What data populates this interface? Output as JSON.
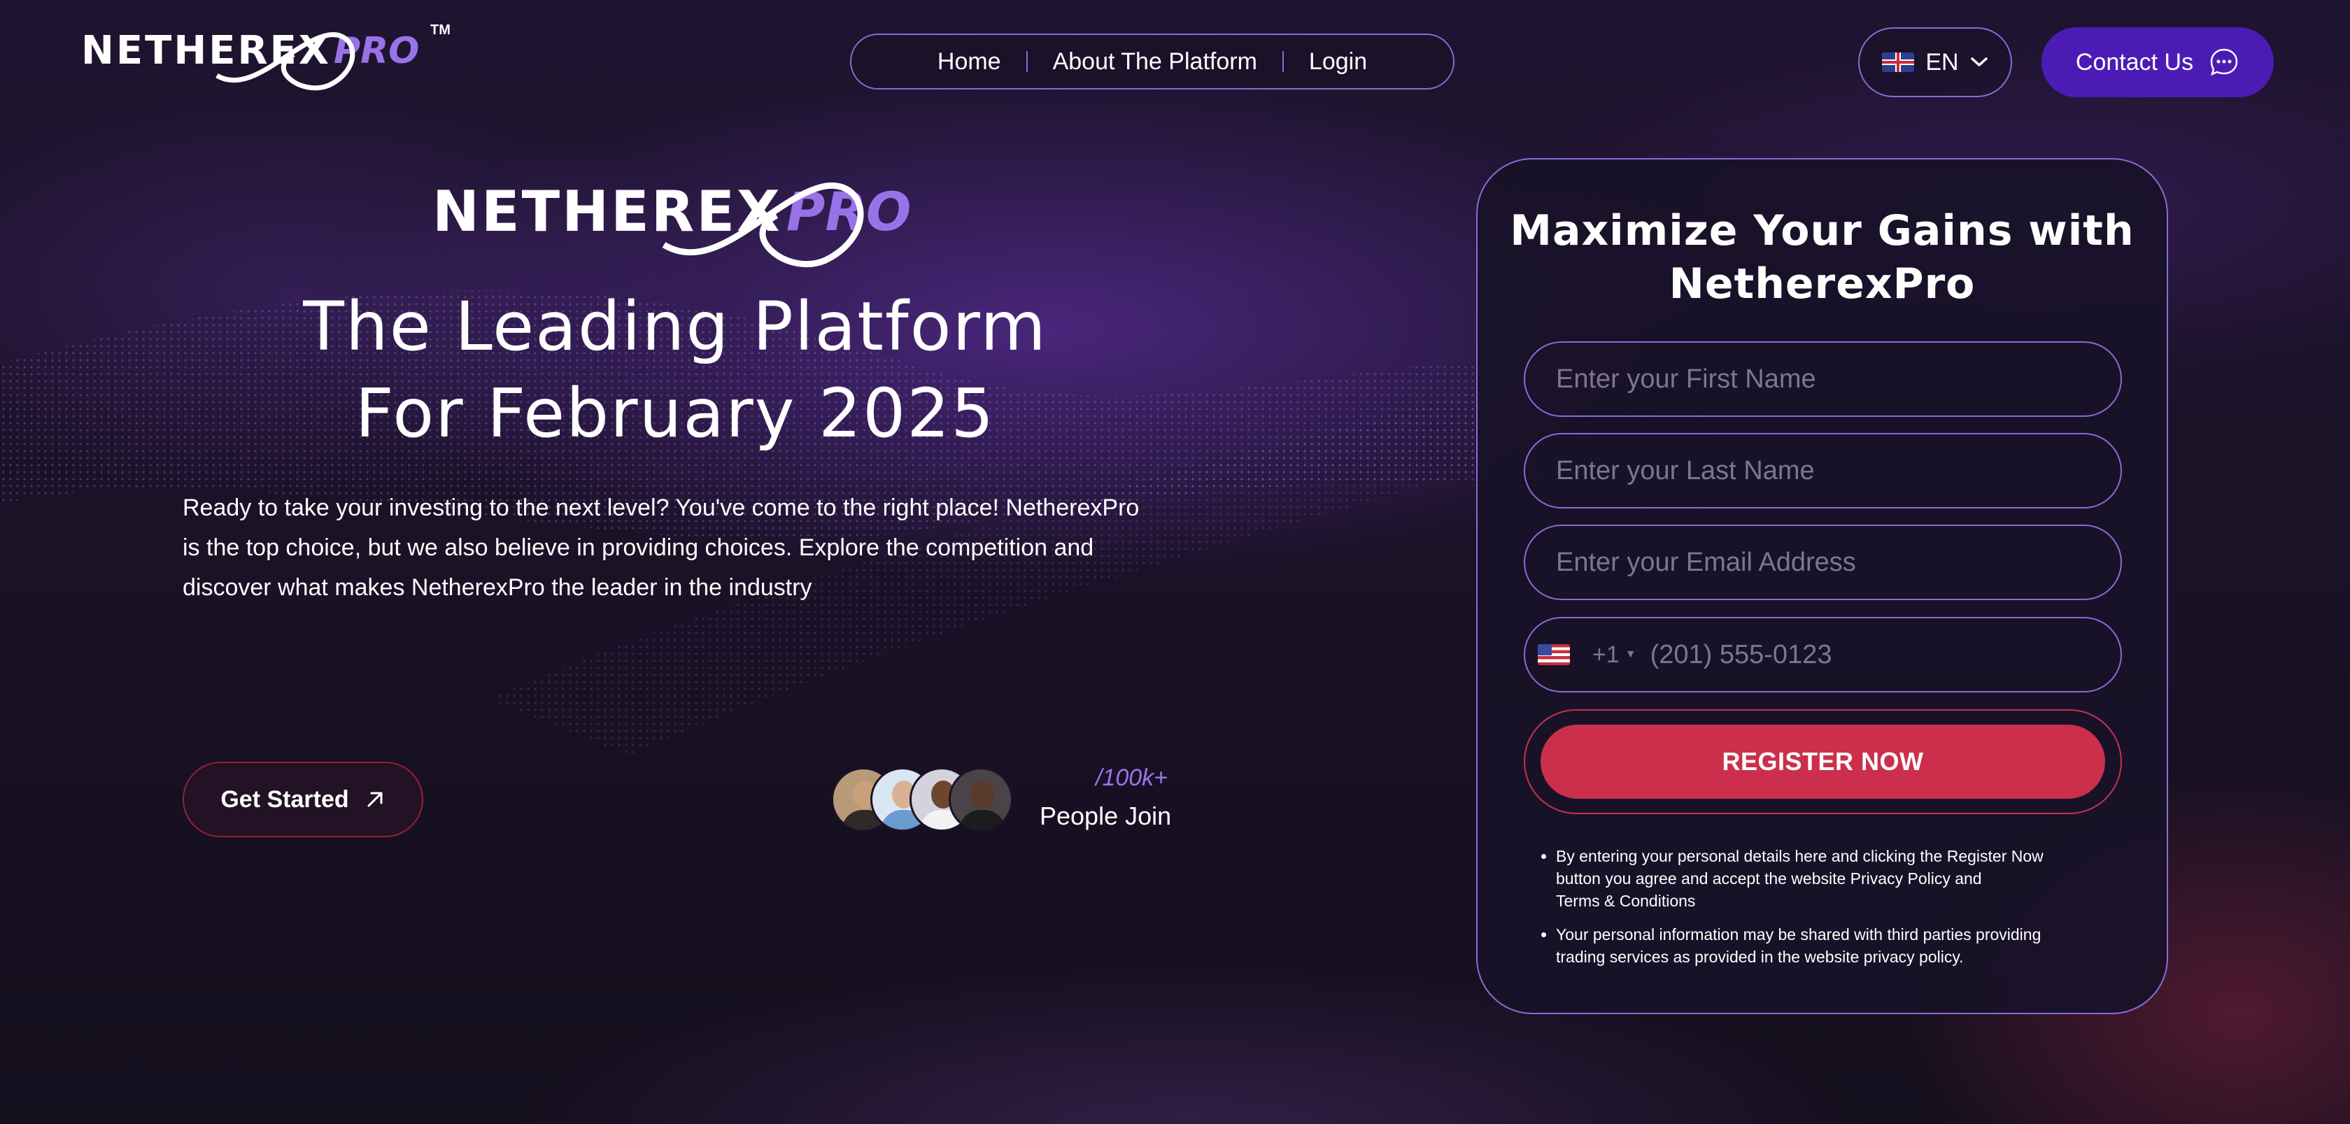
{
  "brand": {
    "name": "NETHEREX",
    "suffix": "PRO",
    "trademark": "TM"
  },
  "nav": {
    "items": [
      {
        "label": "Home"
      },
      {
        "label": "About The Platform"
      },
      {
        "label": "Login"
      }
    ]
  },
  "language": {
    "code": "EN",
    "flag_icon": "uk-flag-icon"
  },
  "contact": {
    "label": "Contact Us",
    "icon": "chat-bubble-icon"
  },
  "hero": {
    "headline_line1": "The Leading Platform",
    "headline_line2": "For February 2025",
    "intro": "Ready to take your investing to the next level? You've come to the right place! NetherexPro is the top choice, but we also believe in providing choices. Explore the competition and discover what makes NetherexPro the leader in the industry",
    "cta_label": "Get Started",
    "people_count": "/100k+",
    "people_label": "People Join"
  },
  "form": {
    "title_line1": "Maximize Your Gains with",
    "title_line2": "NetherexPro",
    "first_name_placeholder": "Enter your First Name",
    "last_name_placeholder": "Enter your Last Name",
    "email_placeholder": "Enter your Email Address",
    "phone_dial_code": "+1",
    "phone_placeholder": "(201) 555-0123",
    "submit_label": "REGISTER NOW",
    "legal_1_line1": "By entering your personal details here and clicking the Register Now",
    "legal_1_line2": "button you agree and accept the website Privacy Policy and",
    "legal_1_line3": "Terms & Conditions",
    "legal_2_line1": "Your personal information may be shared with third parties providing",
    "legal_2_line2": "trading services as provided in the website privacy policy."
  },
  "colors": {
    "accent": "#4b1cb5",
    "brand_purple": "#9a72e8",
    "cta_red": "#cc2f4b",
    "border": "#8a6ad6"
  }
}
